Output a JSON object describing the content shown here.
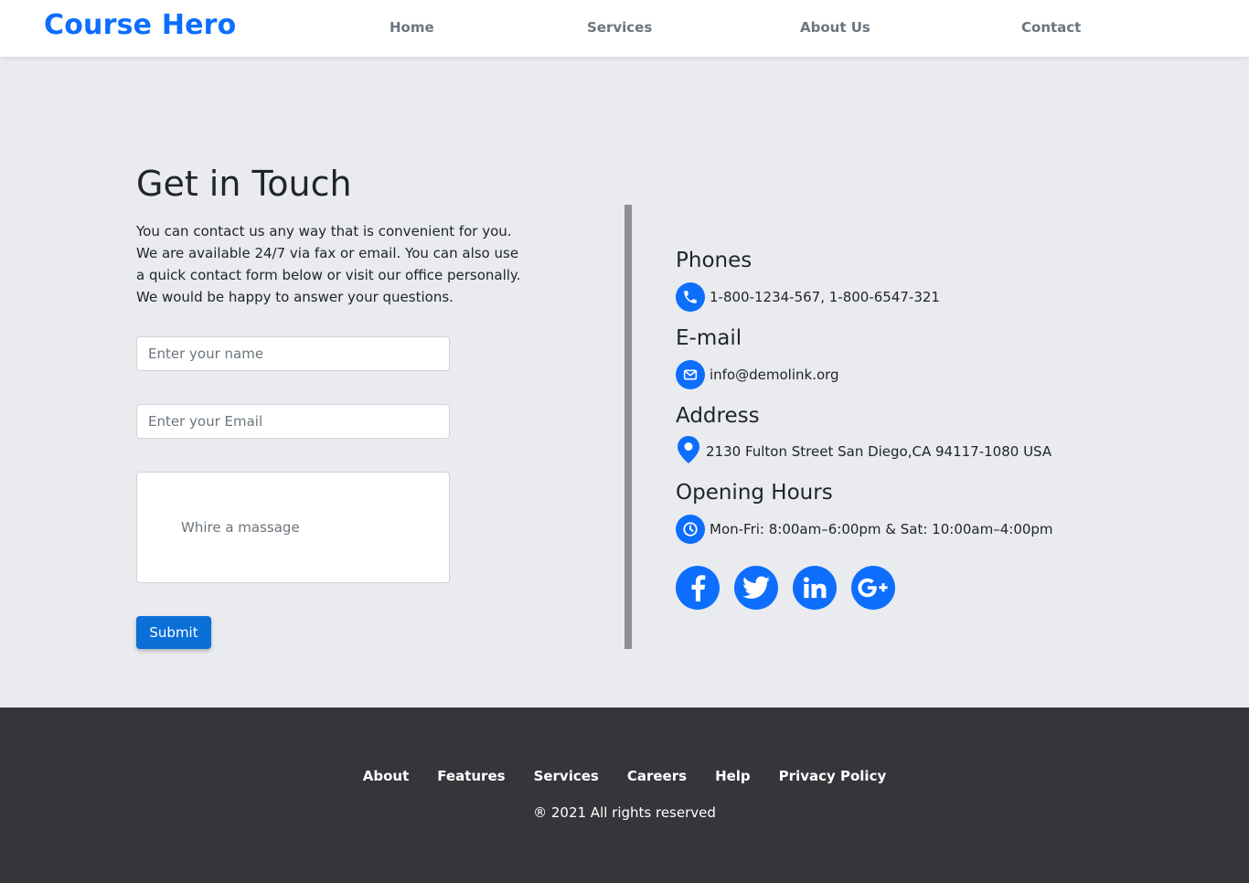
{
  "navbar": {
    "brand": "Course Hero",
    "links": [
      "Home",
      "Services",
      "About Us",
      "Contact"
    ]
  },
  "contact": {
    "title": "Get in Touch",
    "intro": "You can contact us any way that is convenient for you. We are available 24/7 via fax or email. You can also use a quick contact form below or visit our office personally. We would be happy to answer your questions.",
    "form": {
      "name_placeholder": "Enter your name",
      "email_placeholder": "Enter your Email",
      "message_placeholder": "Whire a massage",
      "submit_label": "Submit"
    }
  },
  "info": {
    "phones_heading": "Phones",
    "phones": "1-800-1234-567, 1-800-6547-321",
    "email_heading": "E-mail",
    "email": "info@demolink.org",
    "address_heading": "Address",
    "address": "2130 Fulton Street San Diego,CA 94117-1080 USA",
    "hours_heading": "Opening Hours",
    "hours": "Mon-Fri: 8:00am–6:00pm & Sat: 10:00am–4:00pm",
    "social_icons": [
      "facebook-icon",
      "twitter-icon",
      "linkedin-icon",
      "google-plus-icon"
    ]
  },
  "footer": {
    "links": [
      "About",
      "Features",
      "Services",
      "Careers",
      "Help",
      "Privacy Policy"
    ],
    "copyright": "® 2021 All rights reserved"
  },
  "colors": {
    "brand": "#0d6efd",
    "button": "#0b6fd8",
    "page_bg": "#e9ebef",
    "footer_bg": "#35363a",
    "divider": "#8e8f93"
  }
}
